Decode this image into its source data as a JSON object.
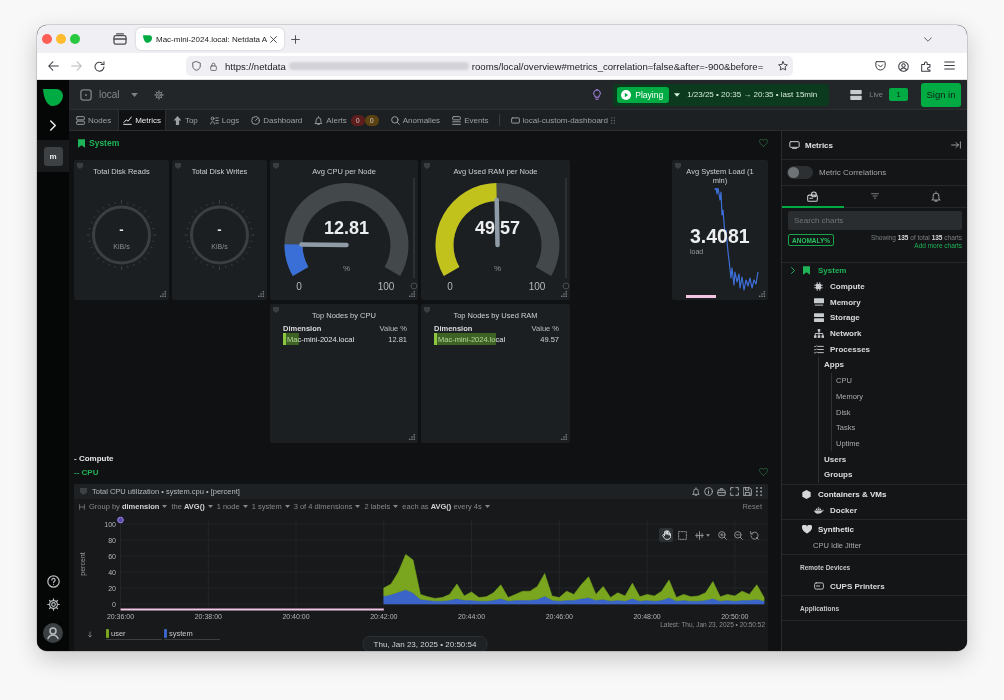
{
  "browser": {
    "tab_title": "Mac-mini-2024.local: Netdata A",
    "back": {
      "disabled": false
    },
    "forward": {
      "disabled": true
    },
    "url_start": "https://netdata",
    "url_end": "rooms/local/overview#metrics_correlation=false&after=-900&before="
  },
  "rail": {
    "spaces": [
      {
        "initial": "m",
        "selected": true
      }
    ]
  },
  "header": {
    "room": "local",
    "play_button": "Playing",
    "time_range": "1/23/25 • 20:35 → 20:35 • last 15min",
    "live_label": "Live",
    "live_count": "1",
    "sign_in": "Sign in"
  },
  "tabs": [
    {
      "label": "Nodes",
      "selected": false
    },
    {
      "label": "Metrics",
      "selected": true
    },
    {
      "label": "Top",
      "selected": false
    },
    {
      "label": "Logs",
      "selected": false
    },
    {
      "label": "Dashboard",
      "selected": false
    },
    {
      "label": "Alerts",
      "selected": false,
      "badges": [
        {
          "count": "0",
          "color": "#5e1d1d"
        },
        {
          "count": "0",
          "color": "#5a4212"
        }
      ]
    },
    {
      "label": "Anomalies",
      "selected": false
    },
    {
      "label": "Events",
      "selected": false
    }
  ],
  "custom_dashboards": [
    {
      "label": "local-custom-dashboard",
      "selected": false
    }
  ],
  "system": {
    "title": "System",
    "cards": [
      {
        "kind": "dial",
        "title": "Total Disk Reads",
        "value": "-",
        "unit": "KiB/s"
      },
      {
        "kind": "dial",
        "title": "Total Disk Writes",
        "value": "-",
        "unit": "KiB/s"
      },
      {
        "kind": "gauge",
        "title": "Avg CPU per Node",
        "value": "12.81",
        "unit": "%",
        "level": 0.1281,
        "color": "#3a6fd8",
        "scale_min": "0",
        "scale_max": "100"
      },
      {
        "kind": "gauge",
        "title": "Avg Used RAM per Node",
        "value": "49.57",
        "unit": "%",
        "level": 0.4957,
        "color": "#c2c21c",
        "scale_min": "0",
        "scale_max": "100"
      },
      {
        "kind": "sparkline",
        "title": "Avg System Load (1 min)",
        "value": "3.4081",
        "unit": "load"
      },
      {
        "kind": "table",
        "title": "Top Nodes by CPU",
        "columns": [
          "Dimension",
          "Value %"
        ],
        "rows": [
          {
            "name": "Mac-mini-2024.local",
            "value": "12.81",
            "level": 0.1281
          }
        ]
      },
      {
        "kind": "table",
        "title": "Top Nodes by Used RAM",
        "columns": [
          "Dimension",
          "Value %"
        ],
        "rows": [
          {
            "name": "Mac-mini-2024.local",
            "value": "49.57",
            "level": 0.4957
          }
        ]
      }
    ]
  },
  "compute": {
    "title": "- Compute",
    "subtitle": "-- CPU"
  },
  "cpu_chart": {
    "title": "Total CPU utilization • system.cpu • [percent]",
    "filters": [
      "Group by **dimension**",
      "the **AVG()**",
      "1 node",
      "1 system",
      "3 of 4 dimensions",
      "2 labels",
      "each as **AVG()** every 4s"
    ],
    "reset": {
      "label": "Reset",
      "disabled": true
    },
    "toolbar": [
      {
        "selected": true
      },
      {
        "selected": false
      },
      {
        "selected": false
      },
      {
        "selected": false
      },
      {
        "selected": false
      },
      {
        "selected": false
      }
    ],
    "latest": "Latest: Thu, Jan 23, 2025 • 20:50:52",
    "chart_data": {
      "type": "area",
      "stacked": true,
      "grid": true,
      "ylabel": "percent",
      "ylim": [
        0,
        100
      ],
      "yticks": [
        0,
        20,
        40,
        60,
        80,
        100
      ],
      "categories": [
        "20:36:00",
        null,
        null,
        null,
        null,
        null,
        null,
        null,
        null,
        null,
        null,
        null,
        "20:38:00",
        null,
        null,
        null,
        null,
        null,
        null,
        null,
        null,
        null,
        null,
        null,
        "20:40:00",
        null,
        null,
        null,
        null,
        null,
        null,
        null,
        null,
        null,
        null,
        null,
        "20:42:00",
        null,
        null,
        null,
        null,
        null,
        null,
        null,
        null,
        null,
        null,
        null,
        "20:44:00",
        null,
        null,
        null,
        null,
        null,
        null,
        null,
        null,
        null,
        null,
        null,
        "20:46:00",
        null,
        null,
        null,
        null,
        null,
        null,
        null,
        null,
        null,
        null,
        null,
        "20:48:00",
        null,
        null,
        null,
        null,
        null,
        null,
        null,
        null,
        null,
        null,
        null,
        "20:50:00",
        null,
        null,
        null,
        null
      ],
      "series": [
        {
          "name": "user",
          "color": "#79a61e",
          "values": [
            null,
            null,
            null,
            null,
            null,
            null,
            null,
            null,
            null,
            null,
            null,
            null,
            null,
            null,
            null,
            null,
            null,
            null,
            null,
            null,
            null,
            null,
            null,
            null,
            null,
            null,
            null,
            null,
            null,
            null,
            null,
            null,
            null,
            null,
            null,
            null,
            10,
            13,
            25,
            44,
            41,
            6,
            4,
            3,
            4,
            7,
            18,
            5,
            10,
            4,
            5,
            9,
            17,
            4,
            7,
            11,
            11,
            16,
            28,
            5,
            4,
            11,
            7,
            17,
            26,
            7,
            16,
            4,
            9,
            6,
            19,
            5,
            7,
            6,
            11,
            22,
            4,
            7,
            5,
            6,
            9,
            21,
            5,
            7,
            6,
            11,
            7,
            18,
            4
          ]
        },
        {
          "name": "system",
          "color": "#3b64c8",
          "values": [
            null,
            null,
            null,
            null,
            null,
            null,
            null,
            null,
            null,
            null,
            null,
            null,
            null,
            null,
            null,
            null,
            null,
            null,
            null,
            null,
            null,
            null,
            null,
            null,
            null,
            null,
            null,
            null,
            null,
            null,
            null,
            null,
            null,
            null,
            null,
            null,
            10,
            12,
            15,
            18,
            14,
            6,
            5,
            4,
            4,
            5,
            7,
            5,
            5,
            4,
            4,
            5,
            7,
            4,
            5,
            5,
            5,
            6,
            10,
            5,
            4,
            5,
            5,
            7,
            8,
            5,
            6,
            4,
            5,
            4,
            7,
            4,
            5,
            4,
            5,
            8,
            4,
            5,
            4,
            4,
            5,
            7,
            4,
            5,
            4,
            5,
            5,
            6,
            4
          ]
        }
      ]
    }
  },
  "timestamp": "Thu, Jan 23, 2025 • 20:50:54",
  "sidebar": {
    "title": "Metrics",
    "correlations": {
      "label": "Metric Correlations",
      "on": false
    },
    "views": [
      {
        "selected": true
      },
      {
        "selected": false
      },
      {
        "selected": false
      }
    ],
    "search": {
      "placeholder": "Search charts"
    },
    "anomaly_button": "ANOMALY%",
    "summary": "Showing **135** of total **135** charts",
    "add_link": "Add more charts",
    "tree": [
      {
        "label": "System",
        "kind": "group",
        "selected": true,
        "children": [
          {
            "label": "Compute",
            "kind": "section"
          },
          {
            "label": "Memory",
            "kind": "section"
          },
          {
            "label": "Storage",
            "kind": "section"
          },
          {
            "label": "Network",
            "kind": "section"
          },
          {
            "label": "Processes",
            "kind": "section",
            "children": [
              {
                "label": "Apps",
                "kind": "section",
                "children": [
                  {
                    "label": "CPU",
                    "kind": "chart"
                  },
                  {
                    "label": "Memory",
                    "kind": "chart"
                  },
                  {
                    "label": "Disk",
                    "kind": "chart"
                  },
                  {
                    "label": "Tasks",
                    "kind": "chart"
                  },
                  {
                    "label": "Uptime",
                    "kind": "chart"
                  }
                ]
              },
              {
                "label": "Users",
                "kind": "section"
              },
              {
                "label": "Groups",
                "kind": "section"
              }
            ]
          }
        ]
      },
      {
        "label": "Containers & VMs",
        "kind": "group",
        "selected": false,
        "children": [
          {
            "label": "Docker",
            "kind": "section"
          }
        ]
      },
      {
        "label": "Synthetic",
        "kind": "group",
        "selected": false,
        "children": [
          {
            "label": "CPU Idle Jitter",
            "kind": "chart"
          }
        ]
      },
      {
        "label": "Remote Devices",
        "kind": "header",
        "selected": false,
        "children": [
          {
            "label": "CUPS Printers",
            "kind": "section"
          }
        ]
      },
      {
        "label": "Applications",
        "kind": "header",
        "selected": false
      }
    ]
  }
}
